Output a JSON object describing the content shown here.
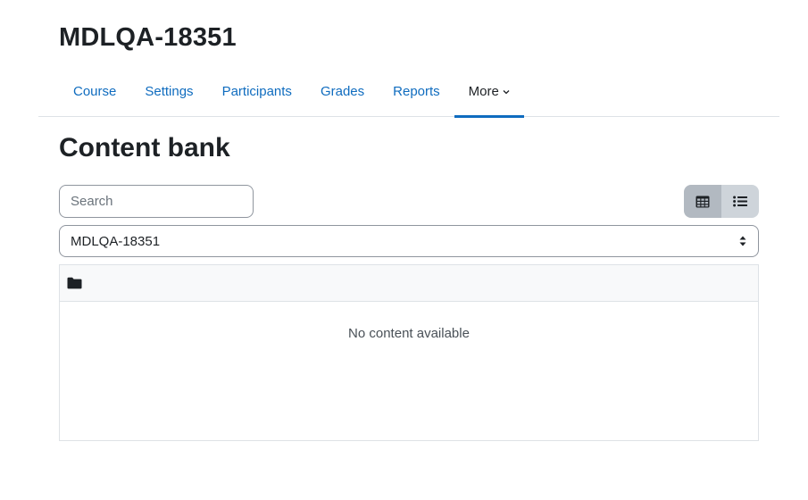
{
  "course": {
    "title": "MDLQA-18351"
  },
  "nav": {
    "items": [
      {
        "label": "Course"
      },
      {
        "label": "Settings"
      },
      {
        "label": "Participants"
      },
      {
        "label": "Grades"
      },
      {
        "label": "Reports"
      },
      {
        "label": "More"
      }
    ],
    "active": "More"
  },
  "page": {
    "heading": "Content bank"
  },
  "search": {
    "placeholder": "Search",
    "value": ""
  },
  "view_toggle": {
    "options": [
      {
        "icon": "grid-icon",
        "selected": true
      },
      {
        "icon": "list-icon",
        "selected": false
      }
    ]
  },
  "context_select": {
    "value": "MDLQA-18351"
  },
  "panel": {
    "header_icon": "folder-icon",
    "empty_message": "No content available"
  },
  "colors": {
    "link": "#0f6cbf",
    "active_underline": "#0f6cbf",
    "text": "#1d2125"
  }
}
